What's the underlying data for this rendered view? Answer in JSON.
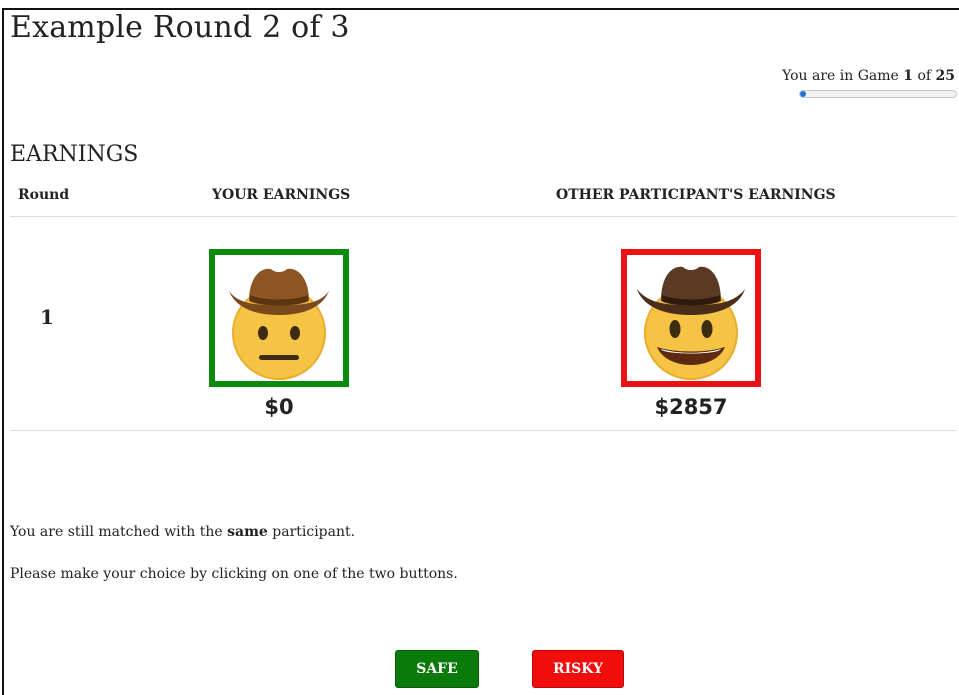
{
  "page": {
    "title": "Example Round 2 of 3"
  },
  "progress": {
    "prefix": "You are in Game ",
    "current": "1",
    "middle": " of ",
    "total": "25",
    "fraction": 0.04,
    "color": "#1d6fd6"
  },
  "earnings": {
    "section_title": "EARNINGS",
    "headers": {
      "round": "Round",
      "yours": "YOUR EARNINGS",
      "other": "OTHER PARTICIPANT'S EARNINGS"
    },
    "rows": [
      {
        "round": "1",
        "yours_amount": "$0",
        "yours_icon": "neutral-cowboy-emoji-icon",
        "yours_border": "#0b8a0b",
        "other_amount": "$2857",
        "other_icon": "grinning-cowboy-emoji-icon",
        "other_border": "#ee1111"
      }
    ]
  },
  "messages": {
    "matched_prefix": "You are still matched with the ",
    "matched_bold": "same",
    "matched_suffix": " participant.",
    "instruction": "Please make your choice by clicking on one of the two buttons."
  },
  "buttons": {
    "safe_label": "SAFE",
    "safe_color": "#0a7a0a",
    "risky_label": "RISKY",
    "risky_color": "#f20d0d"
  }
}
